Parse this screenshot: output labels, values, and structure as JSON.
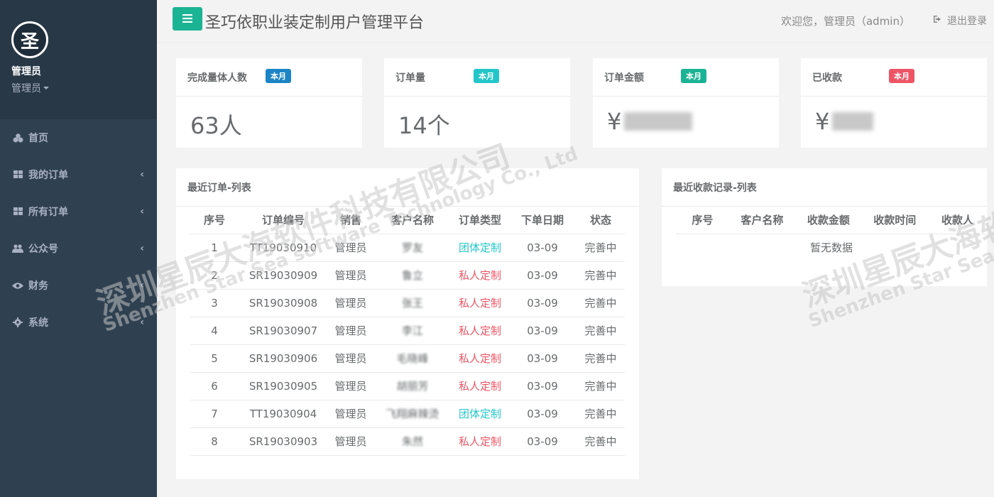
{
  "sidebar": {
    "logo_char": "圣",
    "user_name": "管理员",
    "user_role": "管理员",
    "items": [
      {
        "label": "首页",
        "icon": "dashboard-icon"
      },
      {
        "label": "我的订单",
        "icon": "grid-icon"
      },
      {
        "label": "所有订单",
        "icon": "grid-icon"
      },
      {
        "label": "公众号",
        "icon": "users-icon"
      },
      {
        "label": "财务",
        "icon": "eye-icon"
      },
      {
        "label": "系统",
        "icon": "gear-icon"
      }
    ]
  },
  "header": {
    "title": "圣巧依职业装定制用户管理平台",
    "welcome": "欢迎您，管理员（admin）",
    "logout": "退出登录"
  },
  "stats": [
    {
      "label": "完成量体人数",
      "badge": "本月",
      "badge_color": "#1c84c6",
      "value": "63人"
    },
    {
      "label": "订单量",
      "badge": "本月",
      "badge_color": "#23c6c8",
      "value": "14个"
    },
    {
      "label": "订单金额",
      "badge": "本月",
      "badge_color": "#1ab394",
      "currency": "¥"
    },
    {
      "label": "已收款",
      "badge": "本月",
      "badge_color": "#ed5565",
      "currency": "¥"
    }
  ],
  "orders": {
    "title": "最近订单-列表",
    "columns": [
      "序号",
      "订单编号",
      "销售",
      "客户名称",
      "订单类型",
      "下单日期",
      "状态"
    ],
    "rows": [
      [
        "1",
        "TT19030910",
        "管理员",
        "罗友",
        "团体定制",
        "03-09",
        "完善中"
      ],
      [
        "2",
        "SR19030909",
        "管理员",
        "鲁立",
        "私人定制",
        "03-09",
        "完善中"
      ],
      [
        "3",
        "SR19030908",
        "管理员",
        "张王",
        "私人定制",
        "03-09",
        "完善中"
      ],
      [
        "4",
        "SR19030907",
        "管理员",
        "李江",
        "私人定制",
        "03-09",
        "完善中"
      ],
      [
        "5",
        "SR19030906",
        "管理员",
        "毛晓峰",
        "私人定制",
        "03-09",
        "完善中"
      ],
      [
        "6",
        "SR19030905",
        "管理员",
        "胡丽芳",
        "私人定制",
        "03-09",
        "完善中"
      ],
      [
        "7",
        "TT19030904",
        "管理员",
        "飞翔麻辣烫",
        "团体定制",
        "03-09",
        "完善中"
      ],
      [
        "8",
        "SR19030903",
        "管理员",
        "朱然",
        "私人定制",
        "03-09",
        "完善中"
      ]
    ]
  },
  "payments": {
    "title": "最近收款记录-列表",
    "columns": [
      "序号",
      "客户名称",
      "收款金额",
      "收款时间",
      "收款人"
    ],
    "empty": "暂无数据"
  },
  "watermark": {
    "cn": "深圳星辰大海软件科技有限公司",
    "en": "Shenzhen Star Sea software Technology Co., Ltd"
  },
  "colors": {
    "sidebar_bg": "#2f4050",
    "accent": "#1ab394",
    "group_type": "#23c6c8",
    "private_type": "#ed5565"
  }
}
